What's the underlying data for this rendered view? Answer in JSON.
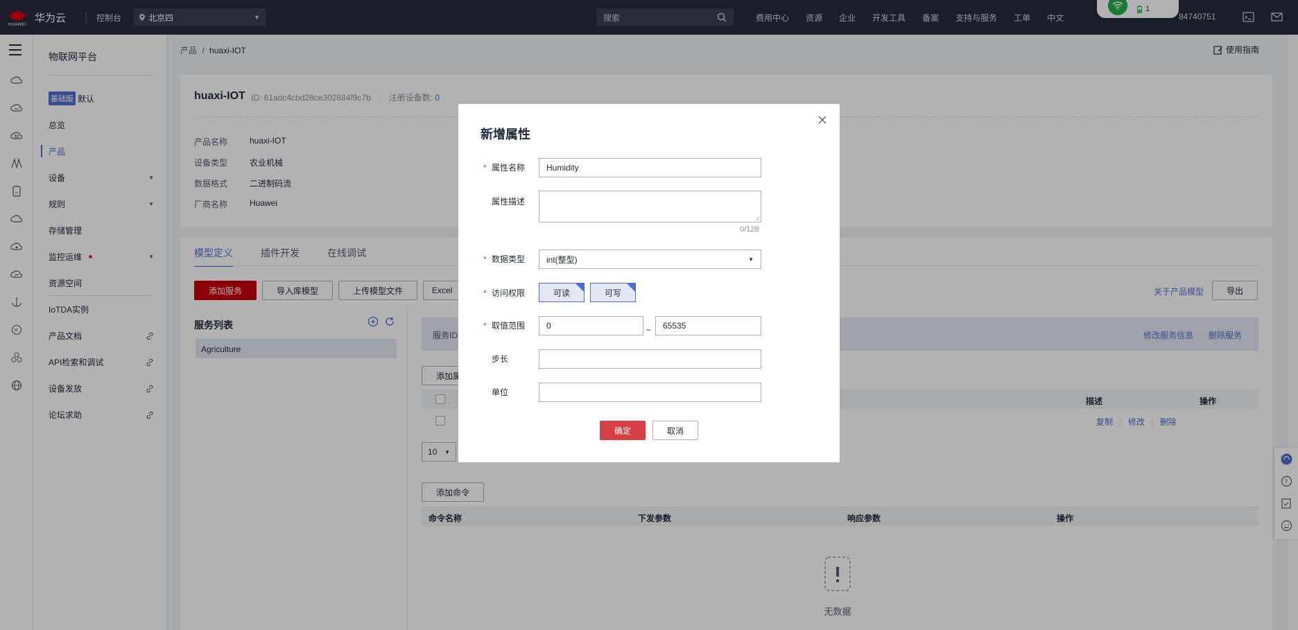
{
  "topbar": {
    "brand": "华为云",
    "logo_word": "HUAWEI",
    "console": "控制台",
    "region": "北京四",
    "search_placeholder": "搜索",
    "nav": [
      "费用中心",
      "资源",
      "企业",
      "开发工具",
      "备案",
      "支持与服务",
      "工单",
      "中文"
    ],
    "account_tail": "84740751",
    "wifi_badge": "1"
  },
  "leftmenu": {
    "title": "物联网平台",
    "edition_badge": "基础版",
    "edition_name": "默认",
    "items": [
      {
        "label": "总览"
      },
      {
        "label": "产品"
      },
      {
        "label": "设备"
      },
      {
        "label": "规则"
      },
      {
        "label": "存储管理"
      },
      {
        "label": "监控运维"
      },
      {
        "label": "资源空间"
      },
      {
        "label": "IoTDA实例"
      },
      {
        "label": "产品文档"
      },
      {
        "label": "API检索和调试"
      },
      {
        "label": "设备发放"
      },
      {
        "label": "论坛求助"
      }
    ]
  },
  "breadcrumb": {
    "root": "产品",
    "sep": "/",
    "current": "huaxi-IOT"
  },
  "guide": "使用指南",
  "product": {
    "name": "huaxi-IOT",
    "id_label": "ID: 61adc4cbd28ce302884f9c7b",
    "devices_label": "注册设备数:",
    "devices_count": "0",
    "fields": [
      {
        "k": "产品名称",
        "v": "huaxi-IOT"
      },
      {
        "k": "设备类型",
        "v": "农业机械"
      },
      {
        "k": "数据格式",
        "v": "二进制码流"
      },
      {
        "k": "厂商名称",
        "v": "Huawei"
      }
    ]
  },
  "tabs": [
    "模型定义",
    "插件开发",
    "在线调试"
  ],
  "toolbar": {
    "add_service": "添加服务",
    "import_lib": "导入库模型",
    "upload": "上传模型文件",
    "excel": "Excel",
    "about": "关于产品模型",
    "export": "导出"
  },
  "services": {
    "title": "服务列表",
    "selected": "Agriculture",
    "bar_left": "服务ID",
    "edit_service": "修改服务信息",
    "delete_service": "删除服务",
    "add_prop": "添加属",
    "prop_cols": {
      "desc": "描述",
      "ops": "操作"
    },
    "row_ops": [
      "复制",
      "修改",
      "删除"
    ],
    "page_size": "10",
    "add_cmd": "添加命令",
    "cmd_cols": [
      "命令名称",
      "下发参数",
      "响应参数",
      "操作"
    ],
    "empty": "无数据"
  },
  "dialog": {
    "title": "新增属性",
    "name_label": "属性名称",
    "name_value": "Humidity",
    "desc_label": "属性描述",
    "desc_counter": "0/128",
    "type_label": "数据类型",
    "type_value": "int(整型)",
    "access_label": "访问权限",
    "access_read": "可读",
    "access_write": "可写",
    "range_label": "取值范围",
    "range_min": "0",
    "range_dash": "–",
    "range_max": "65535",
    "step_label": "步长",
    "unit_label": "单位",
    "ok": "确定",
    "cancel": "取消"
  }
}
